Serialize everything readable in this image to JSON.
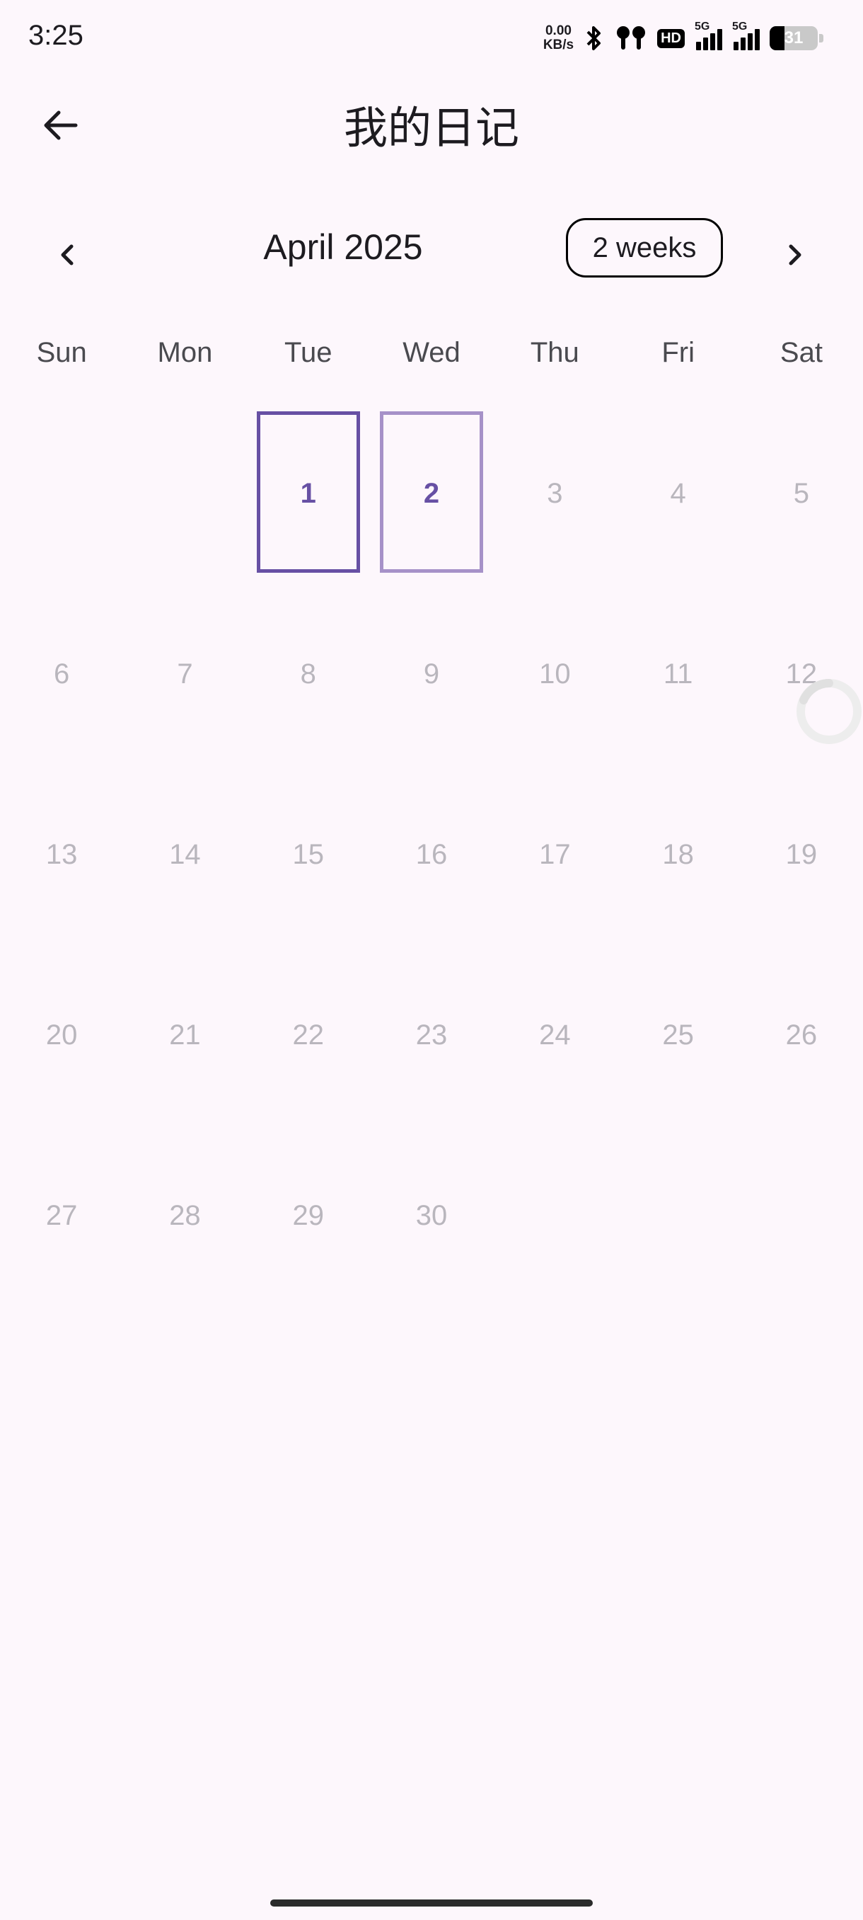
{
  "status_bar": {
    "time": "3:25",
    "net_speed_value": "0.00",
    "net_speed_unit": "KB/s",
    "hd_badge": "HD",
    "signal1_tag": "5G",
    "signal2_tag": "5G",
    "battery_level": "31",
    "battery_fraction": 0.31
  },
  "appbar": {
    "title": "我的日记",
    "back_icon": "arrow-left-icon"
  },
  "calendar": {
    "month_label": "April 2025",
    "format_button_label": "2 weeks",
    "prev_icon": "chevron-left-icon",
    "next_icon": "chevron-right-icon",
    "weekdays": [
      "Sun",
      "Mon",
      "Tue",
      "Wed",
      "Thu",
      "Fri",
      "Sat"
    ],
    "weeks": [
      [
        "",
        "",
        "1",
        "2",
        "3",
        "4",
        "5"
      ],
      [
        "6",
        "7",
        "8",
        "9",
        "10",
        "11",
        "12"
      ],
      [
        "13",
        "14",
        "15",
        "16",
        "17",
        "18",
        "19"
      ],
      [
        "20",
        "21",
        "22",
        "23",
        "24",
        "25",
        "26"
      ],
      [
        "27",
        "28",
        "29",
        "30",
        "",
        "",
        ""
      ]
    ],
    "marked_days": [
      "1",
      "2"
    ],
    "accent_color": "#6750a4",
    "faded_color": "#a691c8"
  }
}
